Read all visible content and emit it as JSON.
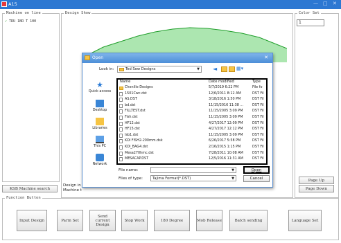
{
  "window": {
    "title": "A15",
    "controls": [
      "—",
      "□",
      "✕"
    ]
  },
  "machine_panel": {
    "legend": "Machine on line",
    "item_checked": true,
    "item_label": "TRU 1BR T 100"
  },
  "design_panel": {
    "legend": "Design Show",
    "partial_text_1": "Design in",
    "partial_text_2": "Machine t"
  },
  "color_panel": {
    "legend": "Color Set",
    "value": "1",
    "page_up": "Page Up",
    "page_down": "Page Down"
  },
  "search_button": "KSB Machine search",
  "function_panel": {
    "legend": "Function Button",
    "buttons": [
      "Input Design",
      "Parm Set",
      "Send current Design",
      "Stop Work",
      "180 Degree",
      "Mob Release",
      "Batch sending",
      "Language Set"
    ]
  },
  "dialog": {
    "title": "Open",
    "look_in_label": "Look in:",
    "look_in_value": "Ted Sew Designs",
    "nav": [
      "Quick access",
      "Desktop",
      "Libraries",
      "This PC",
      "Network"
    ],
    "columns": [
      "Name",
      "Date modified",
      "Type"
    ],
    "files": [
      {
        "name": "Chenille Designs",
        "date": "5/7/2019 6:22 PM",
        "type": "File fo",
        "folder": true
      },
      {
        "name": "1501Cwc.dst",
        "date": "12/6/2011 8:12 AM",
        "type": "DST Fil",
        "folder": false
      },
      {
        "name": "AS.DST",
        "date": "3/18/2016 1:50 PM",
        "type": "DST Fil",
        "folder": false
      },
      {
        "name": "bd.dst",
        "date": "11/15/2016 11:38 ...",
        "type": "DST Fil",
        "folder": false
      },
      {
        "name": "FILLTEST.dst",
        "date": "11/15/2005 3:09 PM",
        "type": "DST Fil",
        "folder": false
      },
      {
        "name": "Fish.dst",
        "date": "11/15/2005 3:09 PM",
        "type": "DST Fil",
        "folder": false
      },
      {
        "name": "HF12.dst",
        "date": "4/27/2017 12:09 PM",
        "type": "DST Fil",
        "folder": false
      },
      {
        "name": "HF15.dst",
        "date": "4/27/2017 12:12 PM",
        "type": "DST Fil",
        "folder": false
      },
      {
        "name": "Isb1.dst",
        "date": "11/15/2005 3:09 PM",
        "type": "DST Fil",
        "folder": false
      },
      {
        "name": "KOI FISH2-200mm.dsk",
        "date": "6/26/2017 5:58 PM",
        "type": "DST Fil",
        "folder": false
      },
      {
        "name": "KOI_BAG4.dst",
        "date": "2/16/2015 1:15 PM",
        "type": "DST Fil",
        "folder": false
      },
      {
        "name": "Mesa270hmc.dst",
        "date": "7/28/2011 10:08 AM",
        "type": "DST Fil",
        "folder": false
      },
      {
        "name": "MESACAP.DST",
        "date": "12/5/2016 11:31 AM",
        "type": "DST Fil",
        "folder": false
      }
    ],
    "filename_label": "File name:",
    "filename_value": "",
    "filetype_label": "Files of type:",
    "filetype_value": "Tajima Format(*.DST)",
    "open_button": "Open",
    "cancel_button": "Cancel"
  },
  "icons": {
    "app": "app-icon",
    "toolbar": [
      "back-arrow-icon",
      "up-folder-icon",
      "new-folder-icon",
      "view-menu-icon"
    ]
  },
  "colors": {
    "titlebar": "#2d78d2",
    "embroidery": "#2fbf3a",
    "dialog_title": "#4c8ed8"
  }
}
